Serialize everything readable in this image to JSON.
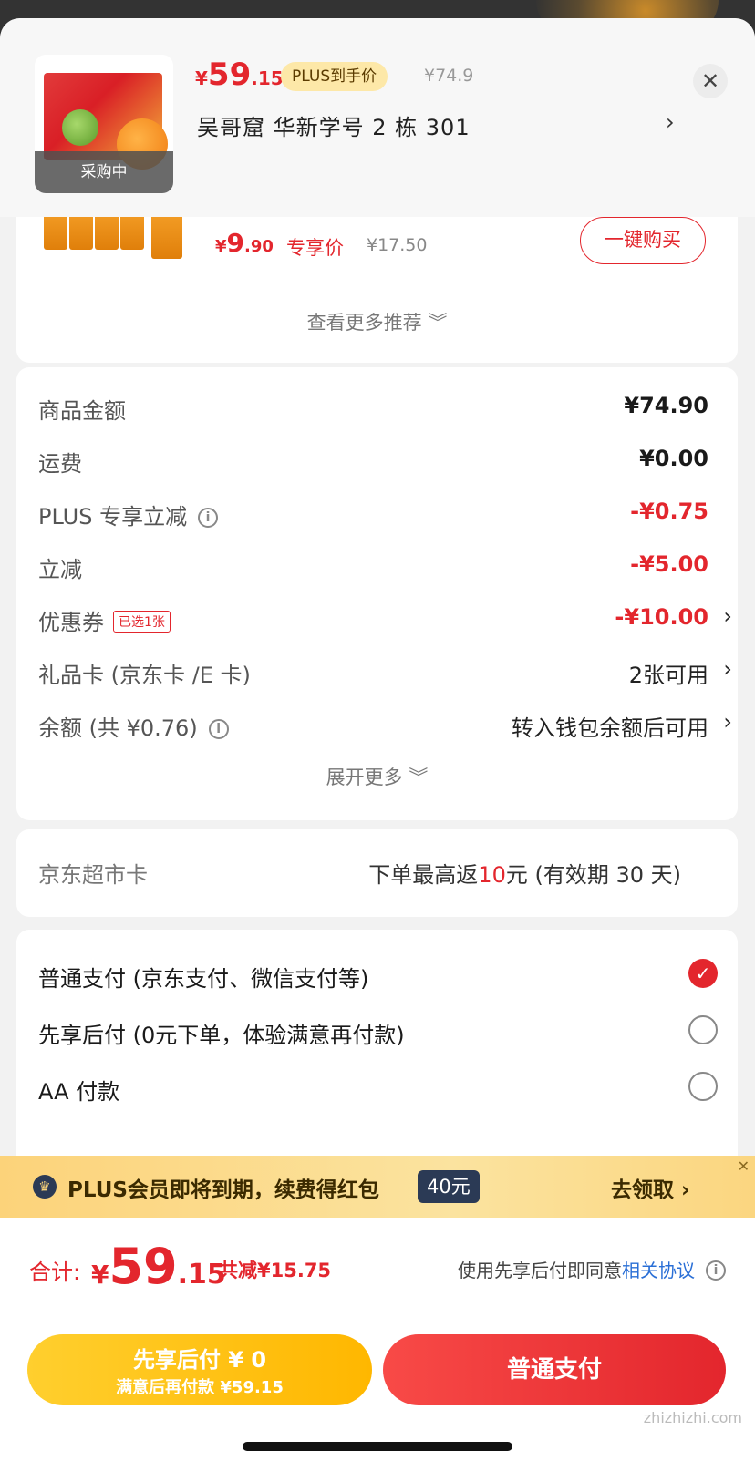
{
  "header": {
    "product_status": "采购中",
    "price_yen": "¥",
    "price_int": "59",
    "price_dec": ".15",
    "plus_badge": "PLUS到手价",
    "orig_price": "¥74.9",
    "address": "吴哥窟  华新学号 2 栋 301",
    "arrow": "›",
    "close": "✕"
  },
  "recommend": {
    "price_yen": "¥",
    "price_int": "9",
    "price_dec": ".90",
    "tag": "专享价",
    "orig_price": "¥17.50",
    "buy_label": "一键购买",
    "more_label": "查看更多推荐 ︾"
  },
  "summary": {
    "rows": [
      {
        "label": "商品金额",
        "value": "¥74.90"
      },
      {
        "label": "运费",
        "value": "¥0.00"
      },
      {
        "label": "PLUS 专享立减",
        "value": "-¥0.75"
      },
      {
        "label": "立减",
        "value": "-¥5.00"
      },
      {
        "label": "优惠券",
        "tag": "已选1张",
        "value": "-¥10.00"
      },
      {
        "label": "礼品卡 (京东卡 /E 卡)",
        "value": "2张可用"
      },
      {
        "label": "余额 (共 ¥0.76)",
        "value": "转入钱包余额后可用"
      }
    ],
    "expand_label": "展开更多 ︾"
  },
  "market_card": {
    "label": "京东超市卡",
    "value_pre": "下单最高返",
    "value_hl": "10",
    "value_post": "元 (有效期 30 天)"
  },
  "payment": {
    "options": [
      {
        "label": "普通支付 (京东支付、微信支付等)",
        "selected": true
      },
      {
        "label": "先享后付 (0元下单，体验满意再付款)",
        "selected": false
      },
      {
        "label": "AA 付款",
        "selected": false
      }
    ]
  },
  "plus_banner": {
    "text": "PLUS会员即将到期，续费得红包",
    "amount": "40元",
    "action": "去领取 ›",
    "close": "✕"
  },
  "bottom": {
    "total_label": "合计:",
    "total_yen": "¥",
    "total_int": "59",
    "total_dec": ".15",
    "saved": "共减¥15.75",
    "agree_pre": "使用先享后付即同意",
    "agree_link": "相关协议",
    "btn_later_l1": "先享后付 ¥ 0",
    "btn_later_l2": "满意后再付款 ¥59.15",
    "btn_pay": "普通支付"
  },
  "watermark": "zhizhizhi.com",
  "colors": {
    "accent": "#e3262d",
    "gold": "#ffb700",
    "link": "#2a6fd6"
  }
}
